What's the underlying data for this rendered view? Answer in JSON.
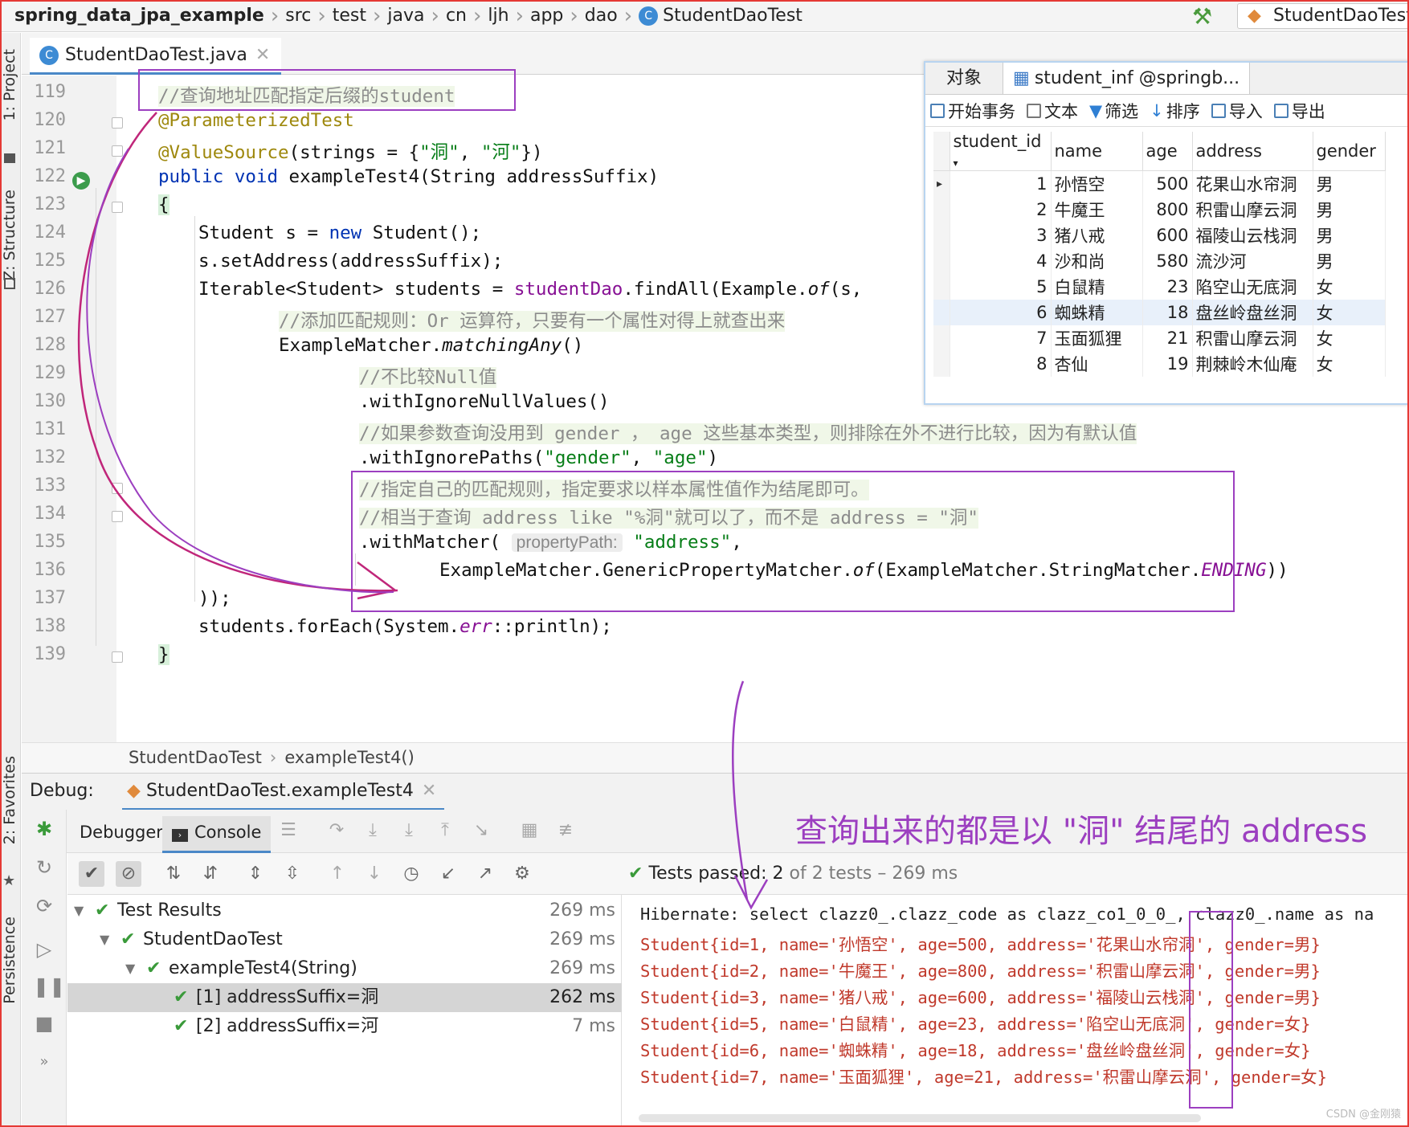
{
  "breadcrumb": [
    "spring_data_jpa_example",
    "src",
    "test",
    "java",
    "cn",
    "ljh",
    "app",
    "dao",
    "StudentDaoTest"
  ],
  "run_config": "StudentDaoTest",
  "left_tools": [
    "1: Project",
    "Z: Structure",
    "2: Favorites",
    "Persistence"
  ],
  "file_tab": "StudentDaoTest.java",
  "code": {
    "line_numbers": [
      "119",
      "120",
      "121",
      "122",
      "123",
      "124",
      "125",
      "126",
      "127",
      "128",
      "129",
      "130",
      "131",
      "132",
      "133",
      "134",
      "135",
      "136",
      "137",
      "138",
      "139"
    ],
    "l119": "//查询地址匹配指定后缀的student",
    "l120": "@ParameterizedTest",
    "l121_ann": "@ValueSource",
    "l121_a": "(strings = {",
    "l121_s1": "\"洞\"",
    "l121_b": ", ",
    "l121_s2": "\"河\"",
    "l121_c": "})",
    "l122_kw": "public void",
    "l122_rest": " exampleTest4(String addressSuffix)",
    "l123": "{",
    "l124_a": "Student s = ",
    "l124_kw": "new",
    "l124_b": " Student();",
    "l125": "s.setAddress(addressSuffix);",
    "l126_a": "Iterable<Student> students = ",
    "l126_fld": "studentDao",
    "l126_b": ".findAll(Example.",
    "l126_of": "of",
    "l126_c": "(s,",
    "l127": "//添加匹配规则：Or 运算符，只要有一个属性对得上就查出来",
    "l128_a": "ExampleMatcher.",
    "l128_it": "matchingAny",
    "l128_b": "()",
    "l129": "//不比较Null值",
    "l130": ".withIgnoreNullValues()",
    "l131": "//如果参数查询没用到 gender ， age 这些基本类型，则排除在外不进行比较，因为有默认值",
    "l132_a": ".withIgnorePaths(",
    "l132_s1": "\"gender\"",
    "l132_b": ", ",
    "l132_s2": "\"age\"",
    "l132_c": ")",
    "l133": "//指定自己的匹配规则，指定要求以样本属性值作为结尾即可。",
    "l134": "//相当于查询 address like \"%洞\"就可以了，而不是 address = \"洞\"",
    "l135_a": ".withMatcher(",
    "l135_hint": "propertyPath:",
    "l135_s": "\"address\"",
    "l135_b": ",",
    "l136_a": "ExampleMatcher.GenericPropertyMatcher.",
    "l136_of": "of",
    "l136_b": "(ExampleMatcher.StringMatcher.",
    "l136_en": "ENDING",
    "l136_c": "))",
    "l137": "));",
    "l138_a": "students.forEach(System.",
    "l138_err": "err",
    "l138_b": "::println);",
    "l139": "}"
  },
  "method_crumb": [
    "StudentDaoTest",
    "exampleTest4()"
  ],
  "db": {
    "tabs": [
      "对象",
      "student_inf @springb..."
    ],
    "toolbar": [
      "开始事务",
      "文本",
      "筛选",
      "排序",
      "导入",
      "导出"
    ],
    "columns": [
      "student_id",
      "name",
      "age",
      "address",
      "gender"
    ],
    "rows": [
      {
        "id": "1",
        "name": "孙悟空",
        "age": "500",
        "address": "花果山水帘洞",
        "gender": "男"
      },
      {
        "id": "2",
        "name": "牛魔王",
        "age": "800",
        "address": "积雷山摩云洞",
        "gender": "男"
      },
      {
        "id": "3",
        "name": "猪八戒",
        "age": "600",
        "address": "福陵山云栈洞",
        "gender": "男"
      },
      {
        "id": "4",
        "name": "沙和尚",
        "age": "580",
        "address": "流沙河",
        "gender": "男"
      },
      {
        "id": "5",
        "name": "白鼠精",
        "age": "23",
        "address": "陷空山无底洞",
        "gender": "女"
      },
      {
        "id": "6",
        "name": "蜘蛛精",
        "age": "18",
        "address": "盘丝岭盘丝洞",
        "gender": "女"
      },
      {
        "id": "7",
        "name": "玉面狐狸",
        "age": "21",
        "address": "积雷山摩云洞",
        "gender": "女"
      },
      {
        "id": "8",
        "name": "杏仙",
        "age": "19",
        "address": "荆棘岭木仙庵",
        "gender": "女"
      }
    ]
  },
  "debug": {
    "label": "Debug:",
    "session": "StudentDaoTest.exampleTest4",
    "tabs": [
      "Debugger",
      "Console"
    ],
    "status_a": "Tests passed: 2",
    "status_b": " of 2 tests – 269 ms",
    "tree": [
      {
        "name": "Test Results",
        "ms": "269 ms"
      },
      {
        "name": "StudentDaoTest",
        "ms": "269 ms"
      },
      {
        "name": "exampleTest4(String)",
        "ms": "269 ms"
      },
      {
        "name": "[1] addressSuffix=洞",
        "ms": "262 ms"
      },
      {
        "name": "[2] addressSuffix=河",
        "ms": "7 ms"
      }
    ],
    "console": [
      "Hibernate: select clazz0_.clazz_code as clazz_co1_0_0_, clazz0_.name as na",
      "Student{id=1, name='孙悟空', age=500, address='花果山水帘洞', gender=男}",
      "Student{id=2, name='牛魔王', age=800, address='积雷山摩云洞', gender=男}",
      "Student{id=3, name='猪八戒', age=600, address='福陵山云栈洞', gender=男}",
      "Student{id=5, name='白鼠精', age=23, address='陷空山无底洞', gender=女}",
      "Student{id=6, name='蜘蛛精', age=18, address='盘丝岭盘丝洞', gender=女}",
      "Student{id=7, name='玉面狐狸', age=21, address='积雷山摩云洞', gender=女}"
    ]
  },
  "annotation": "查询出来的都是以 \"洞\" 结尾的 address",
  "watermark": "CSDN @金刚猿",
  "colors": {
    "accent": "#9c3fc0",
    "frame": "#e53935",
    "pass": "#3a9a3a",
    "error_text": "#c0392b"
  }
}
